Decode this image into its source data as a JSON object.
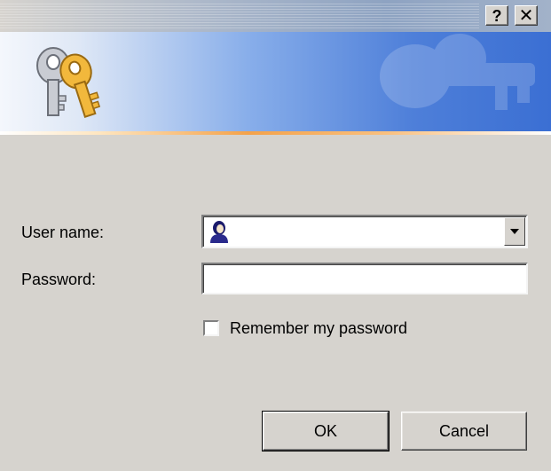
{
  "titlebar": {
    "help_label": "?",
    "close_label": "✕"
  },
  "banner": {
    "icon": "keys-icon"
  },
  "form": {
    "user_label": "User name:",
    "user_value": "",
    "user_icon": "user-icon",
    "password_label": "Password:",
    "password_value": "",
    "remember_label": "Remember my password",
    "remember_checked": false
  },
  "buttons": {
    "ok_label": "OK",
    "cancel_label": "Cancel"
  },
  "colors": {
    "dialog_bg": "#d6d3ce",
    "banner_blue": "#3b6fd3",
    "accent_orange": "#f4a24a"
  }
}
